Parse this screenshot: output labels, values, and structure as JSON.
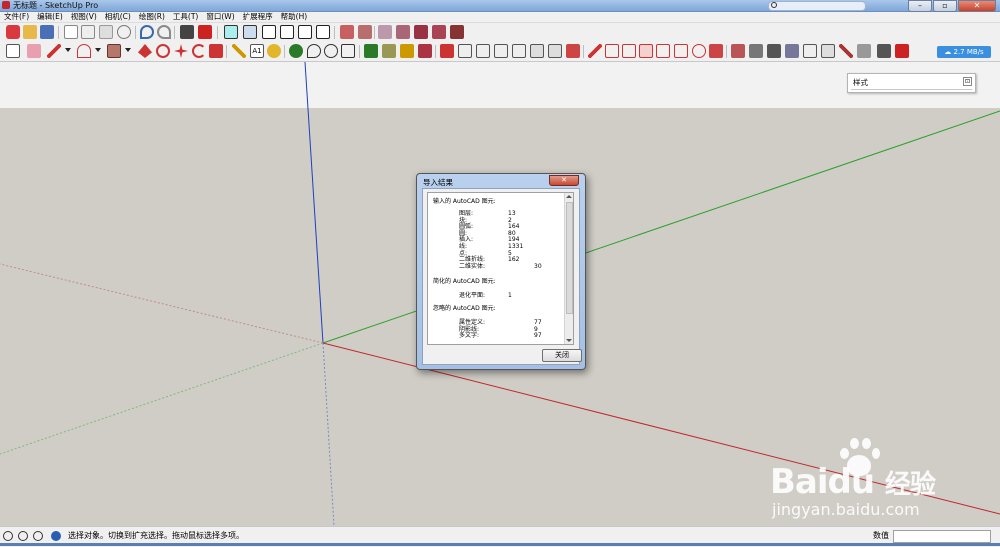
{
  "window": {
    "title": "无标题 - SketchUp Pro"
  },
  "menu": [
    "文件(F)",
    "编辑(E)",
    "视图(V)",
    "相机(C)",
    "绘图(R)",
    "工具(T)",
    "窗口(W)",
    "扩展程序",
    "帮助(H)"
  ],
  "network_speed": "2.7 MB/s",
  "style_panel": {
    "title": "样式",
    "toggle": "⊡"
  },
  "dialog": {
    "title": "导入结果",
    "close_label": "✕",
    "section1_heading": "输入的 AutoCAD 图元:",
    "section1_rows": [
      {
        "label": "图层:",
        "value": "13"
      },
      {
        "label": "块:",
        "value": "2"
      },
      {
        "label": "圆弧:",
        "value": "164"
      },
      {
        "label": "圆:",
        "value": "80"
      },
      {
        "label": "插入:",
        "value": "194"
      },
      {
        "label": "线:",
        "value": "1331"
      },
      {
        "label": "点:",
        "value": "5"
      },
      {
        "label": "二维折线:",
        "value": "162"
      },
      {
        "label": "二维实体:",
        "value": "30"
      }
    ],
    "section2_heading": "简化的 AutoCAD 图元:",
    "section2_rows": [
      {
        "label": "退化平面:",
        "value": "1"
      }
    ],
    "section3_heading": "忽略的 AutoCAD 图元:",
    "section3_rows": [
      {
        "label": "属性定义:",
        "value": "77"
      },
      {
        "label": "阴影线:",
        "value": "9"
      },
      {
        "label": "多文字:",
        "value": "97"
      }
    ],
    "ok_button": "关闭"
  },
  "status": {
    "text": "选择对象。切换到扩充选择。拖动鼠标选择多项。",
    "measurement_label": "数值",
    "measurement_value": ""
  },
  "watermark": {
    "brand": "Baidu",
    "brand_cn": "经验",
    "url": "jingyan.baidu.com"
  },
  "colors": {
    "x_axis": "#c0272d",
    "y_axis": "#2aa02a",
    "z_axis": "#1f3fbf",
    "ground": "#d0cdc6",
    "sky": "#f2f2f2"
  }
}
